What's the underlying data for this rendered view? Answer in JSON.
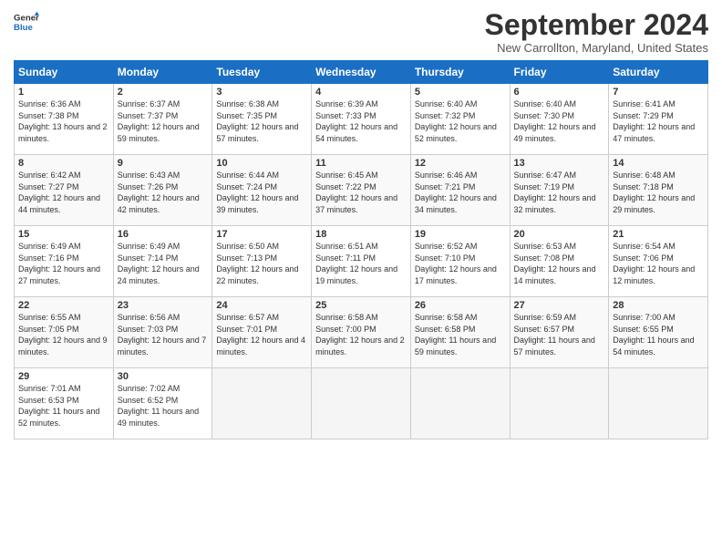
{
  "header": {
    "logo_line1": "General",
    "logo_line2": "Blue",
    "month": "September 2024",
    "location": "New Carrollton, Maryland, United States"
  },
  "weekdays": [
    "Sunday",
    "Monday",
    "Tuesday",
    "Wednesday",
    "Thursday",
    "Friday",
    "Saturday"
  ],
  "weeks": [
    [
      {
        "day": "1",
        "sunrise": "6:36 AM",
        "sunset": "7:38 PM",
        "daylight": "13 hours and 2 minutes."
      },
      {
        "day": "2",
        "sunrise": "6:37 AM",
        "sunset": "7:37 PM",
        "daylight": "12 hours and 59 minutes."
      },
      {
        "day": "3",
        "sunrise": "6:38 AM",
        "sunset": "7:35 PM",
        "daylight": "12 hours and 57 minutes."
      },
      {
        "day": "4",
        "sunrise": "6:39 AM",
        "sunset": "7:33 PM",
        "daylight": "12 hours and 54 minutes."
      },
      {
        "day": "5",
        "sunrise": "6:40 AM",
        "sunset": "7:32 PM",
        "daylight": "12 hours and 52 minutes."
      },
      {
        "day": "6",
        "sunrise": "6:40 AM",
        "sunset": "7:30 PM",
        "daylight": "12 hours and 49 minutes."
      },
      {
        "day": "7",
        "sunrise": "6:41 AM",
        "sunset": "7:29 PM",
        "daylight": "12 hours and 47 minutes."
      }
    ],
    [
      {
        "day": "8",
        "sunrise": "6:42 AM",
        "sunset": "7:27 PM",
        "daylight": "12 hours and 44 minutes."
      },
      {
        "day": "9",
        "sunrise": "6:43 AM",
        "sunset": "7:26 PM",
        "daylight": "12 hours and 42 minutes."
      },
      {
        "day": "10",
        "sunrise": "6:44 AM",
        "sunset": "7:24 PM",
        "daylight": "12 hours and 39 minutes."
      },
      {
        "day": "11",
        "sunrise": "6:45 AM",
        "sunset": "7:22 PM",
        "daylight": "12 hours and 37 minutes."
      },
      {
        "day": "12",
        "sunrise": "6:46 AM",
        "sunset": "7:21 PM",
        "daylight": "12 hours and 34 minutes."
      },
      {
        "day": "13",
        "sunrise": "6:47 AM",
        "sunset": "7:19 PM",
        "daylight": "12 hours and 32 minutes."
      },
      {
        "day": "14",
        "sunrise": "6:48 AM",
        "sunset": "7:18 PM",
        "daylight": "12 hours and 29 minutes."
      }
    ],
    [
      {
        "day": "15",
        "sunrise": "6:49 AM",
        "sunset": "7:16 PM",
        "daylight": "12 hours and 27 minutes."
      },
      {
        "day": "16",
        "sunrise": "6:49 AM",
        "sunset": "7:14 PM",
        "daylight": "12 hours and 24 minutes."
      },
      {
        "day": "17",
        "sunrise": "6:50 AM",
        "sunset": "7:13 PM",
        "daylight": "12 hours and 22 minutes."
      },
      {
        "day": "18",
        "sunrise": "6:51 AM",
        "sunset": "7:11 PM",
        "daylight": "12 hours and 19 minutes."
      },
      {
        "day": "19",
        "sunrise": "6:52 AM",
        "sunset": "7:10 PM",
        "daylight": "12 hours and 17 minutes."
      },
      {
        "day": "20",
        "sunrise": "6:53 AM",
        "sunset": "7:08 PM",
        "daylight": "12 hours and 14 minutes."
      },
      {
        "day": "21",
        "sunrise": "6:54 AM",
        "sunset": "7:06 PM",
        "daylight": "12 hours and 12 minutes."
      }
    ],
    [
      {
        "day": "22",
        "sunrise": "6:55 AM",
        "sunset": "7:05 PM",
        "daylight": "12 hours and 9 minutes."
      },
      {
        "day": "23",
        "sunrise": "6:56 AM",
        "sunset": "7:03 PM",
        "daylight": "12 hours and 7 minutes."
      },
      {
        "day": "24",
        "sunrise": "6:57 AM",
        "sunset": "7:01 PM",
        "daylight": "12 hours and 4 minutes."
      },
      {
        "day": "25",
        "sunrise": "6:58 AM",
        "sunset": "7:00 PM",
        "daylight": "12 hours and 2 minutes."
      },
      {
        "day": "26",
        "sunrise": "6:58 AM",
        "sunset": "6:58 PM",
        "daylight": "11 hours and 59 minutes."
      },
      {
        "day": "27",
        "sunrise": "6:59 AM",
        "sunset": "6:57 PM",
        "daylight": "11 hours and 57 minutes."
      },
      {
        "day": "28",
        "sunrise": "7:00 AM",
        "sunset": "6:55 PM",
        "daylight": "11 hours and 54 minutes."
      }
    ],
    [
      {
        "day": "29",
        "sunrise": "7:01 AM",
        "sunset": "6:53 PM",
        "daylight": "11 hours and 52 minutes."
      },
      {
        "day": "30",
        "sunrise": "7:02 AM",
        "sunset": "6:52 PM",
        "daylight": "11 hours and 49 minutes."
      },
      null,
      null,
      null,
      null,
      null
    ]
  ]
}
